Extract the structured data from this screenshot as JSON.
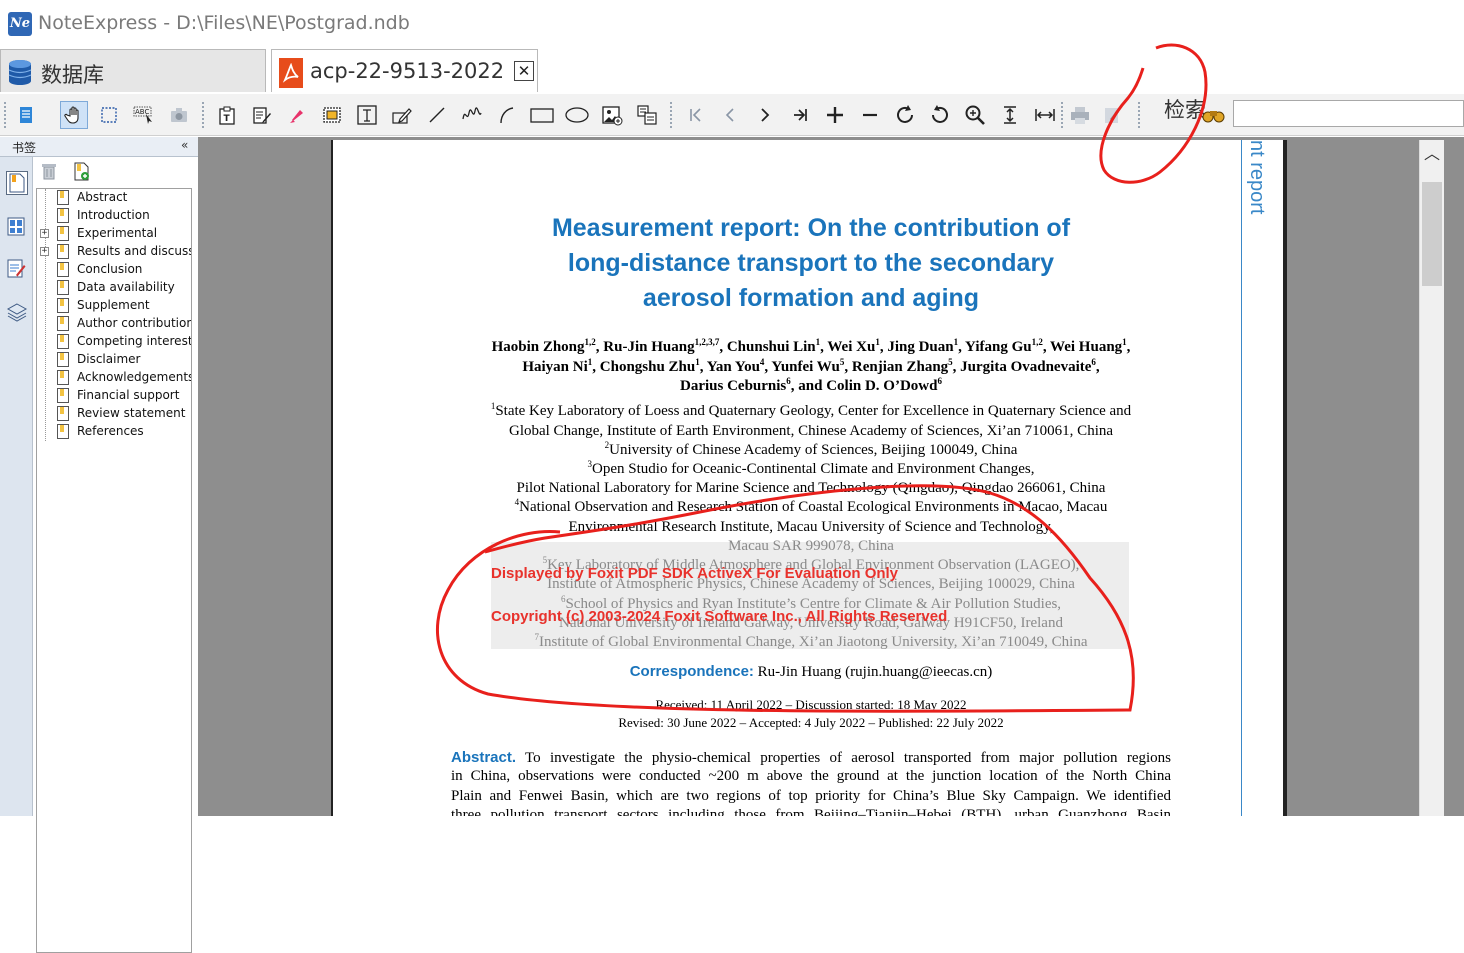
{
  "window": {
    "title": "NoteExpress - D:\\Files\\NE\\Postgrad.ndb",
    "logo_text": "Ne"
  },
  "tabs": [
    {
      "label": "数据库"
    },
    {
      "label": "acp-22-9513-2022",
      "close": "✕"
    }
  ],
  "toolbar": {
    "search_label": "检索",
    "search_value": ""
  },
  "bookmarks": {
    "header": "书签",
    "collapse": "«",
    "items": [
      {
        "label": "Abstract",
        "expandable": false
      },
      {
        "label": "Introduction",
        "expandable": false
      },
      {
        "label": "Experimental",
        "expandable": true
      },
      {
        "label": "Results and discussion",
        "expandable": true
      },
      {
        "label": "Conclusion",
        "expandable": false
      },
      {
        "label": "Data availability",
        "expandable": false
      },
      {
        "label": "Supplement",
        "expandable": false
      },
      {
        "label": "Author contributions",
        "expandable": false
      },
      {
        "label": "Competing interests",
        "expandable": false
      },
      {
        "label": "Disclaimer",
        "expandable": false
      },
      {
        "label": "Acknowledgements",
        "expandable": false
      },
      {
        "label": "Financial support",
        "expandable": false
      },
      {
        "label": "Review statement",
        "expandable": false
      },
      {
        "label": "References",
        "expandable": false
      }
    ]
  },
  "document": {
    "side_label": "nt report",
    "title_lines": [
      "Measurement report: On the contribution of",
      "long-distance transport to the secondary",
      "aerosol formation and aging"
    ],
    "authors_html": [
      "Haobin Zhong<sup>1,2</sup>, Ru-Jin Huang<sup>1,2,3,7</sup>, Chunshui Lin<sup>1</sup>, Wei Xu<sup>1</sup>, Jing Duan<sup>1</sup>, Yifang Gu<sup>1,2</sup>, Wei Huang<sup>1</sup>,",
      "Haiyan Ni<sup>1</sup>, Chongshu Zhu<sup>1</sup>, Yan You<sup>4</sup>, Yunfei Wu<sup>5</sup>, Renjian Zhang<sup>5</sup>, Jurgita Ovadnevaite<sup>6</sup>,",
      "Darius Ceburnis<sup>6</sup>, and Colin D. O’Dowd<sup>6</sup>"
    ],
    "affiliations_html": [
      "<sup>1</sup>State Key Laboratory of Loess and Quaternary Geology, Center for Excellence in Quaternary Science and",
      "Global Change, Institute of Earth Environment, Chinese Academy of Sciences, Xi’an 710061, China",
      "<sup>2</sup>University of Chinese Academy of Sciences, Beijing 100049, China",
      "<sup>3</sup>Open Studio for Oceanic-Continental Climate and Environment Changes,",
      "Pilot National Laboratory for Marine Science and Technology (Qingdao), Qingdao 266061, China",
      "<sup>4</sup>National Observation and Research Station of Coastal Ecological Environments in Macao, Macau",
      "Environmental Research Institute, Macau University of Science and Technology,",
      "Macau SAR 999078, China",
      "<sup>5</sup>Key Laboratory of Middle Atmosphere and Global Environment Observation (LAGEO),",
      "Institute of Atmospheric Physics, Chinese Academy of Sciences, Beijing 100029, China",
      "<sup>6</sup>School of Physics and Ryan Institute’s Centre for Climate &amp; Air Pollution Studies,",
      "National University of Ireland Galway, University Road, Galway H91CF50, Ireland",
      "<sup>7</sup>Institute of Global Environmental Change, Xi’an Jiaotong University, Xi’an 710049, China"
    ],
    "watermark_lines": [
      "Displayed by Foxit PDF SDK ActiveX For Evaluation Only",
      "Copyright (c) 2003-2024 Foxit Software Inc., All Rights Reserved"
    ],
    "correspondence_label": "Correspondence:",
    "correspondence_value": "Ru-Jin Huang (rujin.huang@ieecas.cn)",
    "dates": [
      "Received: 11 April 2022 – Discussion started: 18 May 2022",
      "Revised: 30 June 2022 – Accepted: 4 July 2022 – Published: 22 July 2022"
    ],
    "abstract_label": "Abstract.",
    "abstract_lines": [
      "To investigate the physio-chemical properties of aerosol transported from major pollution regions",
      "in China, observations were conducted ~200 m above the ground at the junction location of the North China",
      "Plain and Fenwei Basin, which are two regions of top priority for China’s Blue Sky Campaign. We identified",
      "three pollution transport sectors including those from Beijing–Tianjin–Hebei (BTH), urban Guanzhong Basin"
    ]
  },
  "colors": {
    "accent": "#1a74bb",
    "watermark": "#e8322c",
    "annotation": "#e8201c",
    "pdf_tab": "#e74c1b"
  }
}
